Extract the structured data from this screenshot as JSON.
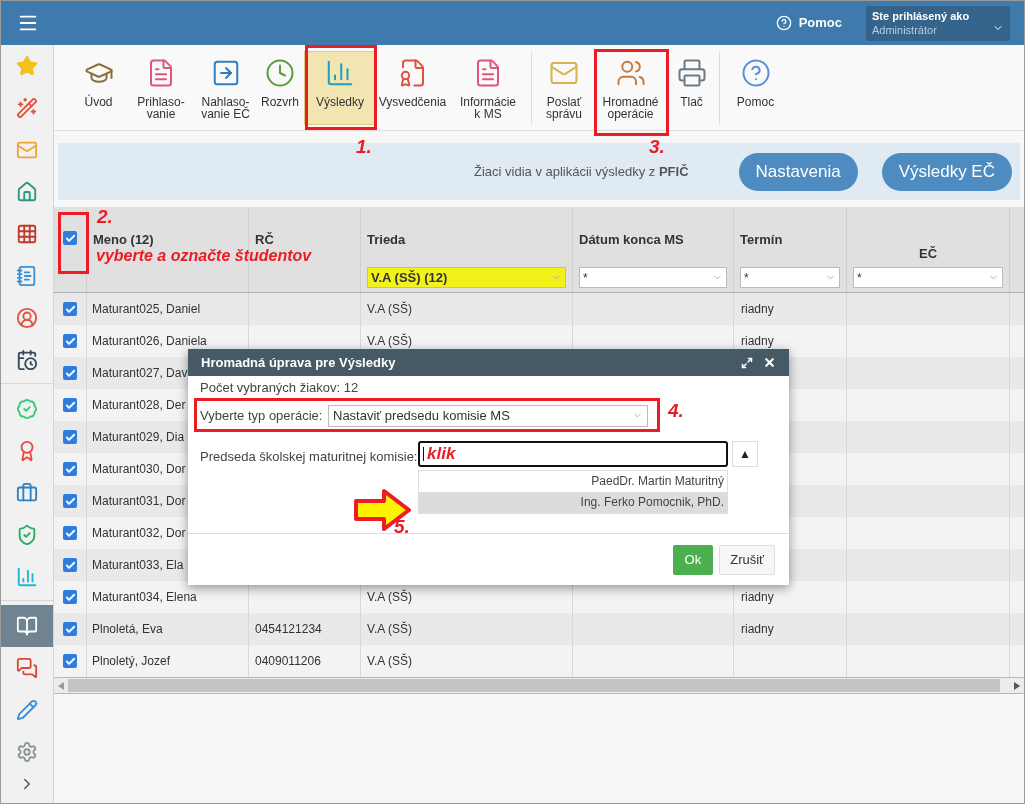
{
  "topbar": {
    "help": "Pomoc",
    "user": {
      "label": "Ste prihlásený ako",
      "name": "Administrátor"
    }
  },
  "sidebar": {
    "groups": [
      [
        {
          "kind": "star",
          "selected": false
        },
        {
          "kind": "wand",
          "selected": false
        },
        {
          "kind": "mail",
          "selected": false
        },
        {
          "kind": "home",
          "selected": false
        },
        {
          "kind": "grid",
          "selected": false
        },
        {
          "kind": "notebook",
          "selected": false
        },
        {
          "kind": "person",
          "selected": false
        },
        {
          "kind": "calendar",
          "selected": false
        }
      ],
      [
        {
          "kind": "check",
          "selected": false
        },
        {
          "kind": "grade",
          "selected": false
        },
        {
          "kind": "briefcase",
          "selected": false
        },
        {
          "kind": "shield",
          "selected": false
        },
        {
          "kind": "chart",
          "selected": false
        }
      ],
      [
        {
          "kind": "book",
          "selected": true
        },
        {
          "kind": "chat",
          "selected": false
        },
        {
          "kind": "pen",
          "selected": false
        },
        {
          "kind": "gear",
          "selected": false
        }
      ]
    ]
  },
  "toolbar": {
    "groups": [
      [
        {
          "label": "Úvod",
          "kind": "graduates",
          "selected": false
        },
        {
          "label": "Prihlaso-\nvanie",
          "kind": "form",
          "selected": false
        },
        {
          "label": "Nahlaso-\nvanie EČ",
          "kind": "arrow",
          "selected": false
        },
        {
          "label": "Rozvrh",
          "kind": "clock",
          "selected": false
        },
        {
          "label": "Výsledky",
          "kind": "chart",
          "selected": true
        },
        {
          "label": "Vysvedčenia",
          "kind": "certificate",
          "selected": false
        },
        {
          "label": "Informácie\nk MS",
          "kind": "form",
          "selected": false
        }
      ],
      [
        {
          "label": "Poslať\nsprávu",
          "kind": "envelope",
          "selected": false
        },
        {
          "label": "Hromadné\noperácie",
          "kind": "people",
          "selected": false
        },
        {
          "label": "Tlač",
          "kind": "printer",
          "selected": false
        }
      ],
      [
        {
          "label": "Pomoc",
          "kind": "help",
          "selected": false
        }
      ]
    ]
  },
  "info_bar": {
    "text": "Žiaci vidia v aplikácii výsledky z **PFIČ**",
    "buttons": [
      "Nastavenia",
      "Výsledky EČ"
    ]
  },
  "table": {
    "select_all": true,
    "columns": [
      {
        "label": "Meno (12)"
      },
      {
        "label": "RČ"
      },
      {
        "label": "Trieda",
        "filter": "V.A (SŠ) (12)",
        "filter_active": true
      },
      {
        "label": "Dátum konca MS",
        "filter": "*",
        "filter_active": false
      },
      {
        "label": "Termín",
        "filter": "*",
        "filter_active": false
      },
      {
        "label": "EČ",
        "filter": "*",
        "filter_active": false
      }
    ],
    "rows": [
      {
        "checked": true,
        "name": "Maturant025, Daniel",
        "class": "V.A (SŠ)",
        "term": "riadny"
      },
      {
        "checked": true,
        "name": "Maturant026, Daniela",
        "class": "V.A (SŠ)",
        "term": "riadny"
      },
      {
        "checked": true,
        "name": "Maturant027, Dav"
      },
      {
        "checked": true,
        "name": "Maturant028, Der"
      },
      {
        "checked": true,
        "name": "Maturant029, Dia"
      },
      {
        "checked": true,
        "name": "Maturant030, Dor"
      },
      {
        "checked": true,
        "name": "Maturant031, Dor"
      },
      {
        "checked": true,
        "name": "Maturant032, Dor"
      },
      {
        "checked": true,
        "name": "Maturant033, Ela"
      },
      {
        "checked": true,
        "name": "Maturant034, Elena",
        "class": "V.A (SŠ)",
        "term": "riadny"
      },
      {
        "checked": true,
        "name": "Plnoletá, Eva",
        "rc": "0454121234",
        "class": "V.A (SŠ)",
        "term": "riadny"
      },
      {
        "checked": true,
        "name": "Plnoletý, Jozef",
        "rc": "0409011206",
        "class": "V.A (SŠ)"
      }
    ]
  },
  "dialog": {
    "title": "Hromadná úprava pre Výsledky",
    "count": "Počet vybraných žiakov: 12",
    "operation": {
      "label": "Vyberte typ operácie:",
      "value": "Nastaviť predsedu komisie MS"
    },
    "chair": {
      "label": "Predseda školskej maturitnej komisie:",
      "value": "klik",
      "toggle": "▲",
      "options": [
        {
          "label": "PaedDr. Martin Maturitný",
          "selected": false
        },
        {
          "label": "Ing. Ferko Pomocnik, PhD.",
          "selected": true
        }
      ]
    },
    "buttons": [
      {
        "label": "Ok",
        "kind": "primary"
      },
      {
        "label": "Zrušiť",
        "kind": "default"
      }
    ]
  },
  "annotations": [
    {
      "kind": "frame"
    },
    {
      "kind": "frame"
    },
    {
      "kind": "frame"
    },
    {
      "kind": "frame"
    },
    {
      "kind": "step",
      "text": "1."
    },
    {
      "kind": "step",
      "text": "2."
    },
    {
      "kind": "step",
      "text": "3."
    },
    {
      "kind": "step",
      "text": "4."
    },
    {
      "kind": "step",
      "text": "5."
    },
    {
      "kind": "note",
      "text": "vyberte a označte študentov"
    },
    {
      "kind": "arrow"
    }
  ]
}
